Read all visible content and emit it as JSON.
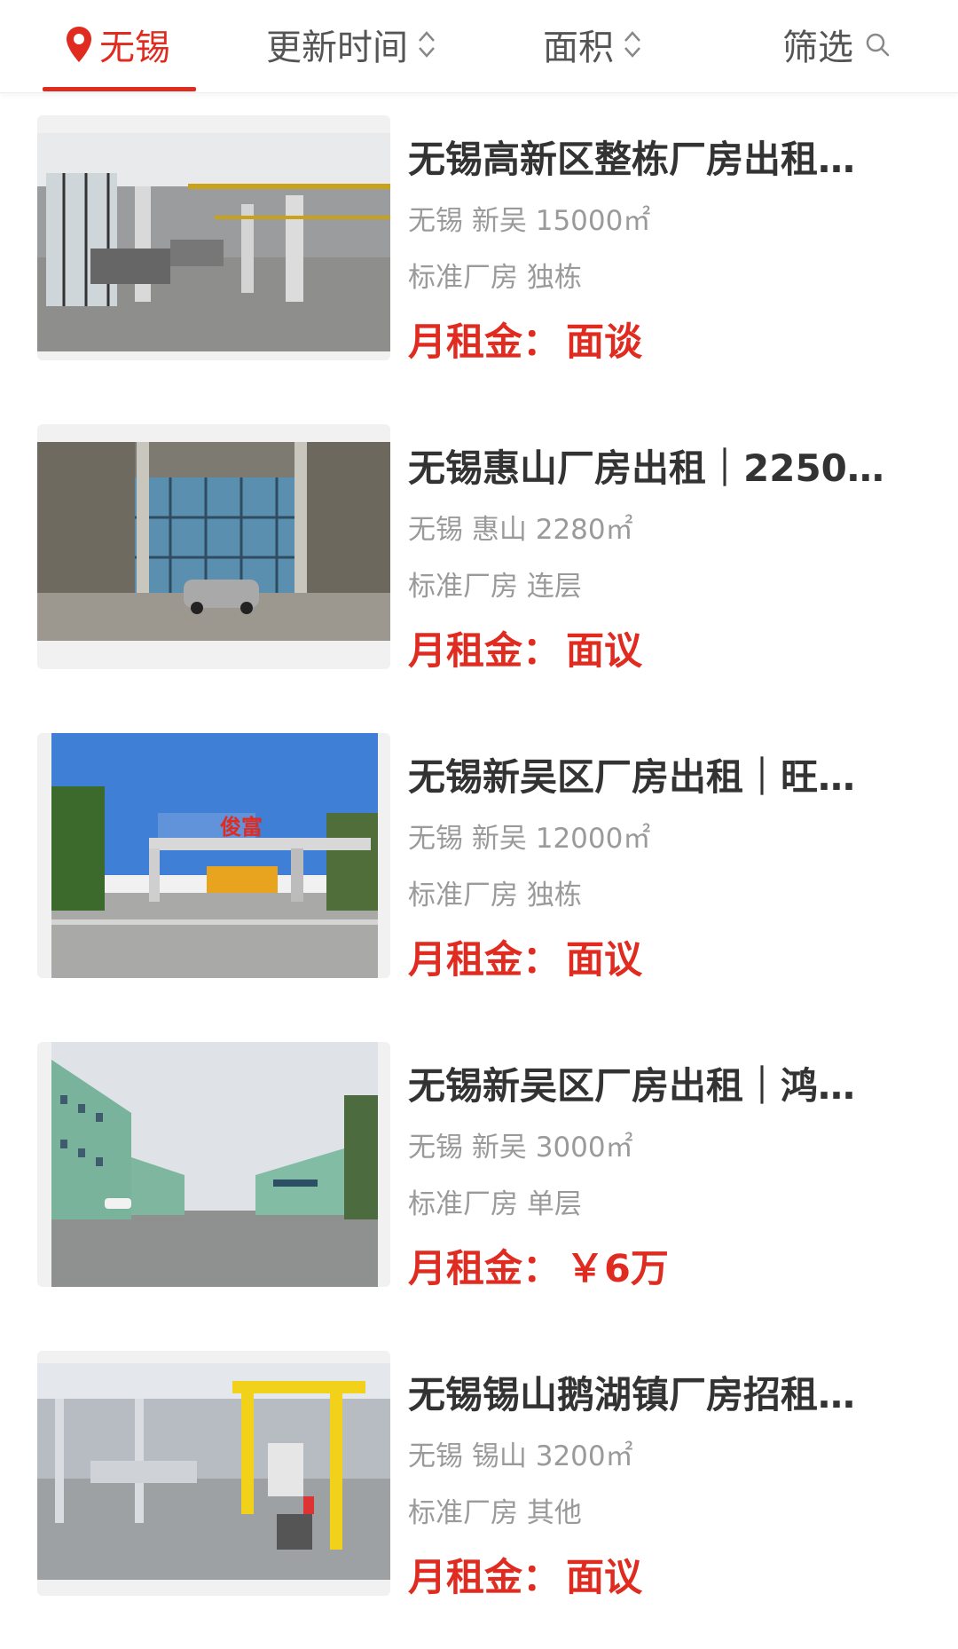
{
  "filter_bar": {
    "city": "无锡",
    "sort_time": "更新时间",
    "sort_area": "面积",
    "filter": "筛选"
  },
  "listings": [
    {
      "title": "无锡高新区整栋厂房出租…",
      "city": "无锡",
      "district": "新吴",
      "area": "15000㎡",
      "type": "标准厂房",
      "structure": "独栋",
      "price_label": "月租金：",
      "price": "面谈"
    },
    {
      "title": "无锡惠山厂房出租｜2250…",
      "city": "无锡",
      "district": "惠山",
      "area": "2280㎡",
      "type": "标准厂房",
      "structure": "连层",
      "price_label": "月租金：",
      "price": "面议"
    },
    {
      "title": "无锡新吴区厂房出租｜旺…",
      "city": "无锡",
      "district": "新吴",
      "area": "12000㎡",
      "type": "标准厂房",
      "structure": "独栋",
      "price_label": "月租金：",
      "price": "面议",
      "photo_sign": "俊富"
    },
    {
      "title": "无锡新吴区厂房出租｜鸿…",
      "city": "无锡",
      "district": "新吴",
      "area": "3000㎡",
      "type": "标准厂房",
      "structure": "单层",
      "price_label": "月租金：",
      "price": "￥6万"
    },
    {
      "title": "无锡锡山鹅湖镇厂房招租…",
      "city": "无锡",
      "district": "锡山",
      "area": "3200㎡",
      "type": "标准厂房",
      "structure": "其他",
      "price_label": "月租金：",
      "price": "面议"
    }
  ],
  "colors": {
    "accent": "#e02b20",
    "muted_text": "#9a9a9a",
    "title_text": "#333333"
  },
  "icons": {
    "city": "location-pin-icon",
    "sort": "sort-arrows-icon",
    "filter": "search-icon"
  }
}
